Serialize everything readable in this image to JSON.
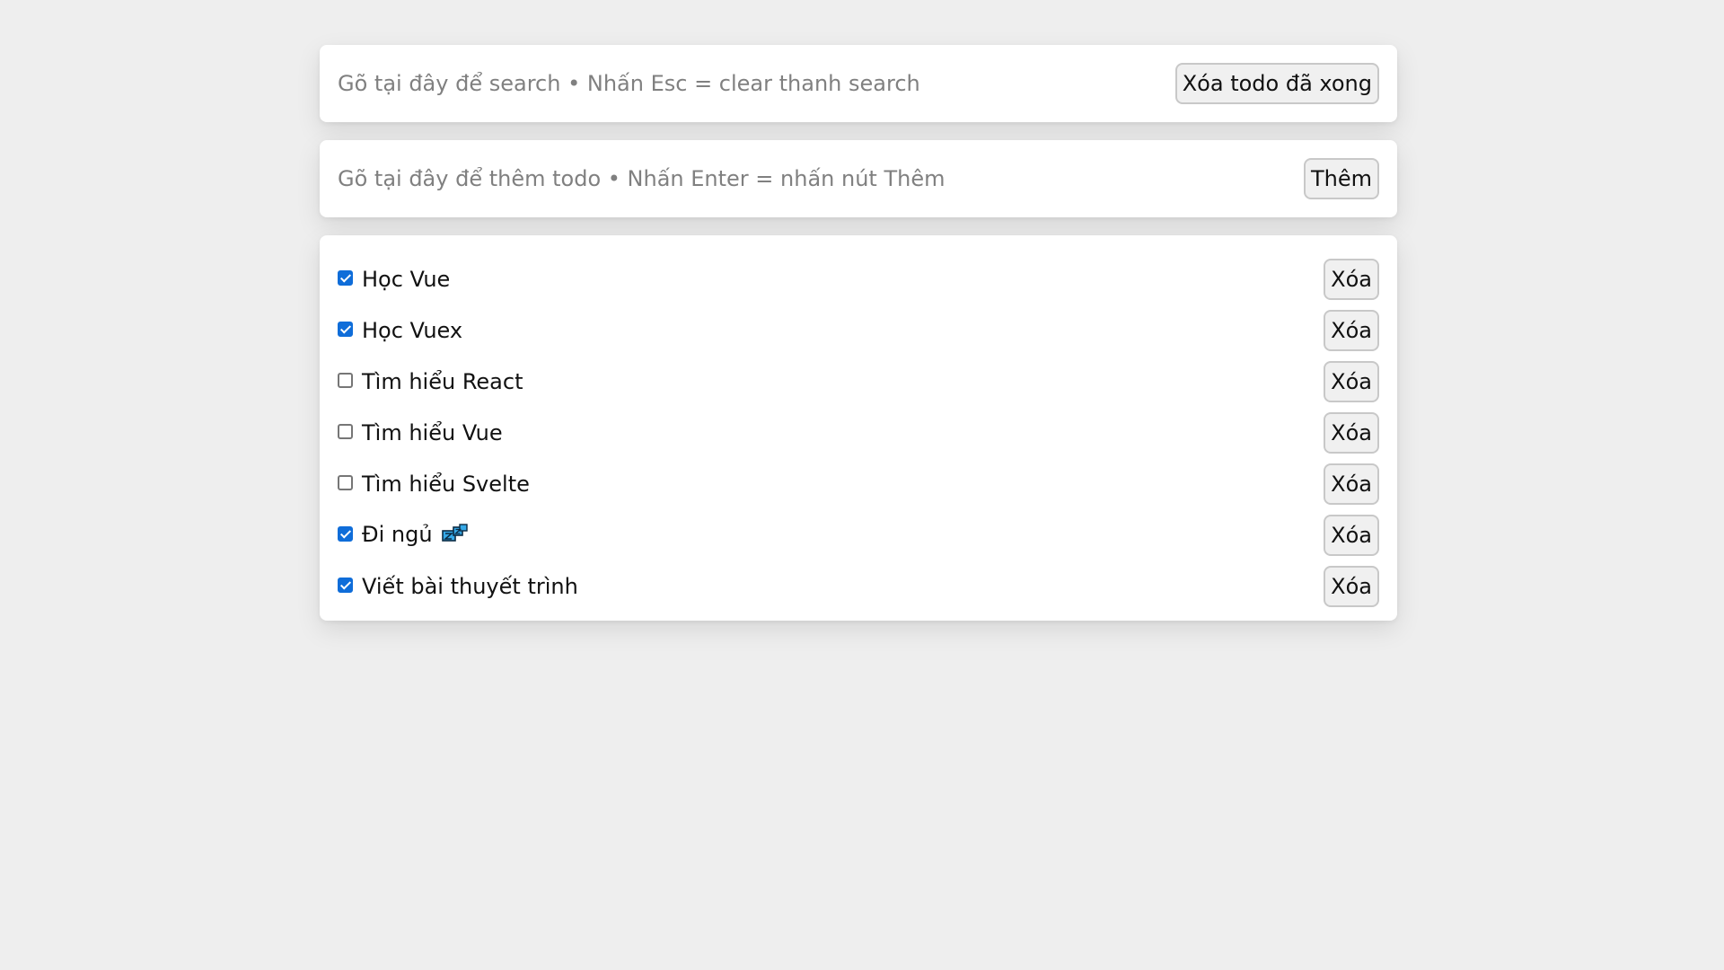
{
  "search": {
    "placeholder": "Gõ tại đây để search • Nhấn Esc = clear thanh search",
    "clear_done_label": "Xóa todo đã xong"
  },
  "add": {
    "placeholder": "Gõ tại đây để thêm todo • Nhấn Enter = nhấn nút Thêm",
    "add_label": "Thêm"
  },
  "todos": [
    {
      "label": "Học Vue",
      "done": true,
      "delete_label": "Xóa"
    },
    {
      "label": "Học Vuex",
      "done": true,
      "delete_label": "Xóa"
    },
    {
      "label": "Tìm hiểu React",
      "done": false,
      "delete_label": "Xóa"
    },
    {
      "label": "Tìm hiểu Vue",
      "done": false,
      "delete_label": "Xóa"
    },
    {
      "label": "Tìm hiểu Svelte",
      "done": false,
      "delete_label": "Xóa"
    },
    {
      "label": "Đi ngủ",
      "done": true,
      "delete_label": "Xóa",
      "icon": "zzz-sleep-icon"
    },
    {
      "label": "Viết bài thuyết trình",
      "done": true,
      "delete_label": "Xóa"
    }
  ],
  "colors": {
    "background": "#eeeeee",
    "card": "#ffffff",
    "checkbox_checked": "#0f6dd9"
  }
}
